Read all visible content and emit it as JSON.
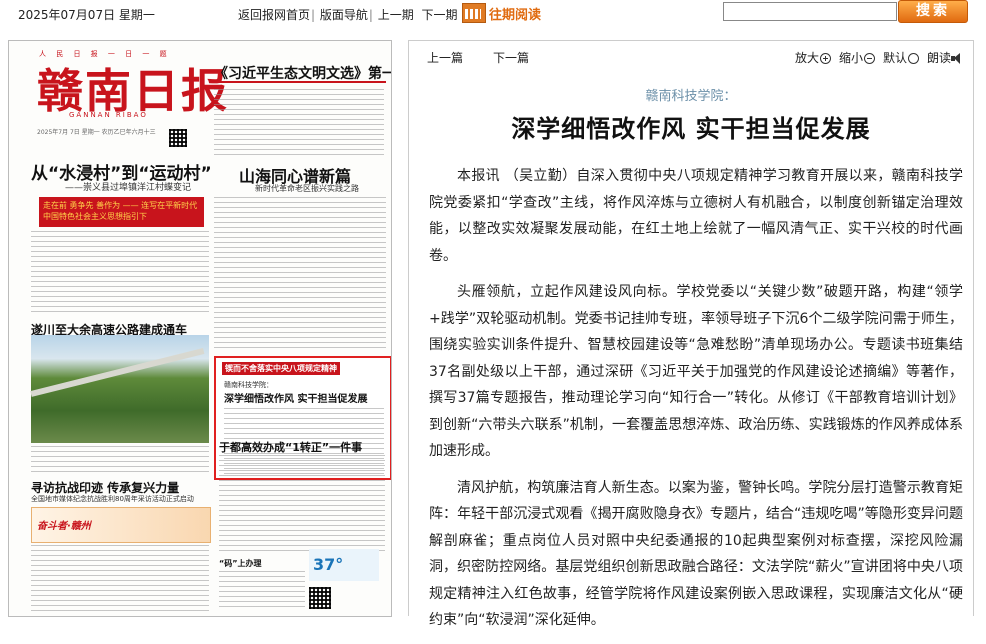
{
  "topbar": {
    "date": "2025年07月07日 星期一",
    "nav": [
      "返回报网首页",
      "版面导航",
      "上一期",
      "下一期"
    ],
    "past_reading": "往期阅读",
    "search_placeholder": "",
    "search_button": "搜索"
  },
  "paper": {
    "masthead": "赣南日报",
    "masthead_top": "人 民 日 报 一 日 一 题",
    "masthead_sub": "GANNAN RIBAO",
    "meta": "2025年7月 7日 星期一 农历乙巳年六月十三",
    "headline_top": "《习近平生态文明文选》第一卷出版发行",
    "headline_left": "从“水浸村”到“运动村”",
    "headline_left_sub": "——崇义县过埠镇洋江村蝶变记",
    "headline_right": "山海同心谱新篇",
    "headline_right_sub": "新时代革命老区振兴实践之路",
    "red_banner": "走在前 勇争先 善作为 —— 连写在平新时代中国特色社会主义思想指引下",
    "headline_road": "遂川至大余高速公路建成通车",
    "headline_bottom": "寻访抗战印迹 传承复兴力量",
    "headline_bottom_sub": "全国地市媒体纪念抗战胜利80周年采访活动正式启动",
    "headline_mid": "于都高效办成“1转正”一件事",
    "headline_small": "“码”上办理",
    "ad_text": "奋斗者·赣州",
    "weather_temp": "37°",
    "highlight": {
      "tag": "锲而不舍落实中央八项规定精神",
      "kicker": "赣南科技学院：",
      "title": "深学细悟改作风 实干担当促发展"
    }
  },
  "article": {
    "toolbar": {
      "prev": "上一篇",
      "next": "下一篇",
      "zoom_in": "放大",
      "zoom_out": "缩小",
      "default": "默认",
      "read": "朗读"
    },
    "kicker": "赣南科技学院：",
    "title": "深学细悟改作风 实干担当促发展",
    "paragraphs": [
      "本报讯 （吴立勤）自深入贯彻中央八项规定精神学习教育开展以来，赣南科技学院党委紧扣“学查改”主线，将作风淬炼与立德树人有机融合，以制度创新锚定治理效能，以整改实效凝聚发展动能，在红土地上绘就了一幅风清气正、实干兴校的时代画卷。",
      "头雁领航，立起作风建设风向标。学校党委以“关键少数”破题开路，构建“领学+践学”双轮驱动机制。党委书记挂帅专班，率领导班子下沉6个二级学院问需于师生，围绕实验实训条件提升、智慧校园建设等“急难愁盼”清单现场办公。专题读书班集结37名副处级以上干部，通过深研《习近平关于加强党的作风建设论述摘编》等著作，撰写37篇专题报告，推动理论学习向“知行合一”转化。从修订《干部教育培训计划》到创新“六带头六联系”机制，一套覆盖思想淬炼、政治历练、实践锻炼的作风养成体系加速形成。",
      "清风护航，构筑廉洁育人新生态。以案为鉴，警钟长鸣。学院分层打造警示教育矩阵：年轻干部沉浸式观看《揭开腐败隐身衣》专题片，结合“违规吃喝”等隐形变异问题解剖麻雀；重点岗位人员对照中央纪委通报的10起典型案例对标查摆，深挖风险漏洞，织密防控网络。基层党组织创新思政融合路径：文法学院“薪火”宣讲团将中央八项规定精神注入红色故事，经管学院将作风建设案例嵌入思政课程，实现廉洁文化从“硬约束”向“软浸润”深化延伸。"
    ]
  }
}
